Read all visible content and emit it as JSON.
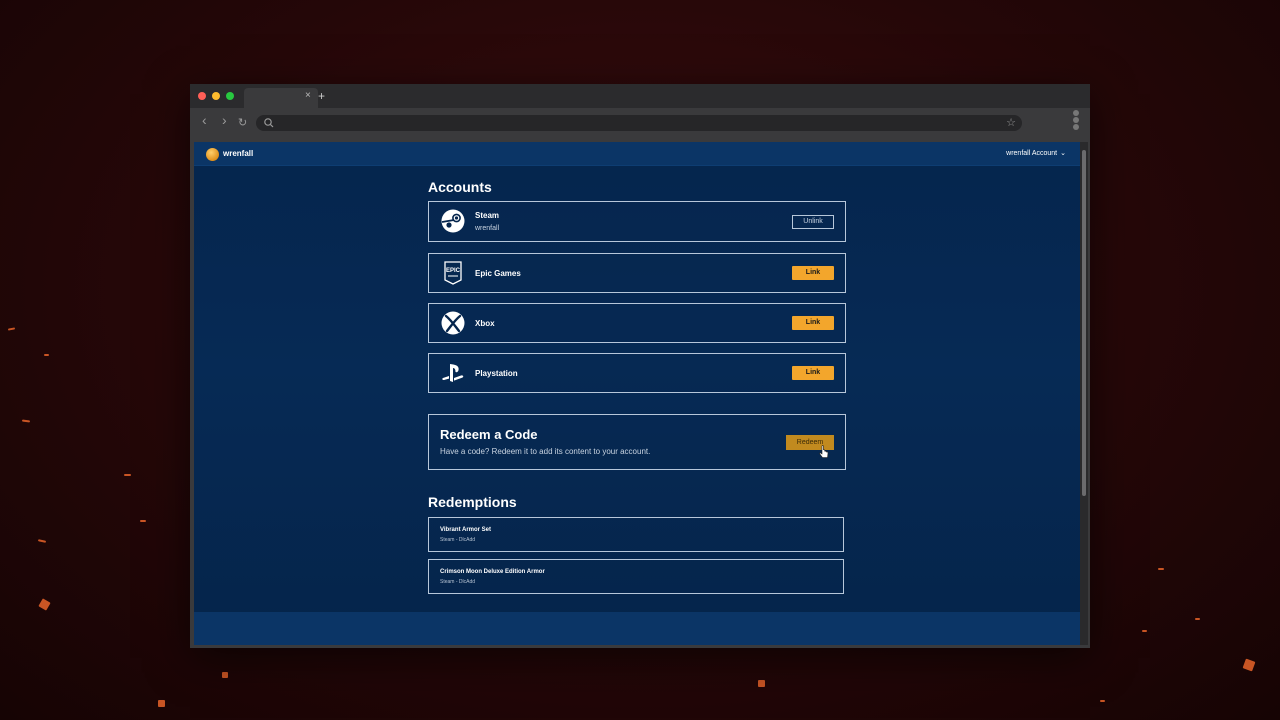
{
  "colors": {
    "page_bg": "#062a55",
    "header_bg": "#0b3566",
    "accent": "#f3a62c",
    "card_border": "#b7c7da",
    "backdrop": "#250708"
  },
  "browser": {
    "tab_close": "×",
    "new_tab": "+",
    "back_icon": "‹",
    "forward_icon": "›",
    "reload_icon": "↻",
    "bookmark_icon": "☆"
  },
  "site": {
    "logo_text": "wrenfall",
    "account_menu": "wrenfall Account"
  },
  "accounts": {
    "title": "Accounts",
    "items": [
      {
        "name": "Steam",
        "username": "wrenfall",
        "action": "Unlink",
        "icon": "steam-icon"
      },
      {
        "name": "Epic Games",
        "action": "Link",
        "icon": "epic-games-icon"
      },
      {
        "name": "Xbox",
        "action": "Link",
        "icon": "xbox-icon"
      },
      {
        "name": "Playstation",
        "action": "Link",
        "icon": "playstation-icon"
      }
    ]
  },
  "redeem": {
    "title": "Redeem a Code",
    "description": "Have a code? Redeem it to add its content to your account.",
    "button": "Redeem"
  },
  "redemptions": {
    "title": "Redemptions",
    "items": [
      {
        "name": "Vibrant Armor Set",
        "detail": "Steam - DlcAdd"
      },
      {
        "name": "Crimson Moon Deluxe Edition Armor",
        "detail": "Steam - DlcAdd"
      }
    ]
  }
}
